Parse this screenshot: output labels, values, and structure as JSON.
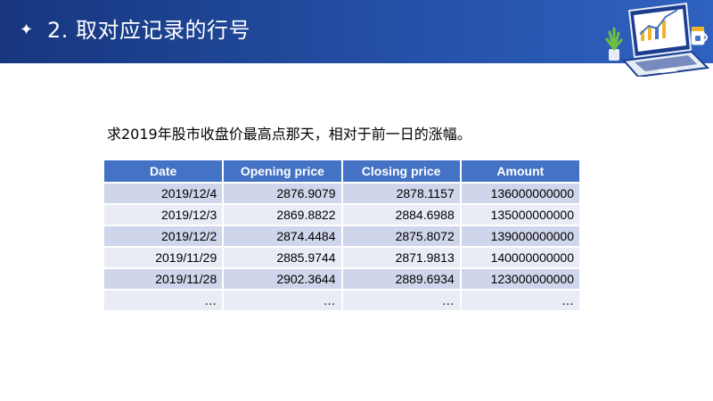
{
  "header": {
    "star_icon": "✦",
    "title": "2. 取对应记录的行号",
    "illustration": "laptop-chart-with-plant-and-mug-icon"
  },
  "prompt": "求2019年股市收盘价最高点那天，相对于前一日的涨幅。",
  "table": {
    "columns": [
      "Date",
      "Opening price",
      "Closing price",
      "Amount"
    ],
    "rows": [
      [
        "2019/12/4",
        "2876.9079",
        "2878.1157",
        "136000000000"
      ],
      [
        "2019/12/3",
        "2869.8822",
        "2884.6988",
        "135000000000"
      ],
      [
        "2019/12/2",
        "2874.4484",
        "2875.8072",
        "139000000000"
      ],
      [
        "2019/11/29",
        "2885.9744",
        "2871.9813",
        "140000000000"
      ],
      [
        "2019/11/28",
        "2902.3644",
        "2889.6934",
        "123000000000"
      ],
      [
        "…",
        "…",
        "…",
        "…"
      ]
    ]
  },
  "colors": {
    "header_dark": "#17367e",
    "header_light": "#2f62c0",
    "table_header": "#4472c4",
    "row_odd": "#cfd5ea",
    "row_even": "#e9ebf5"
  }
}
